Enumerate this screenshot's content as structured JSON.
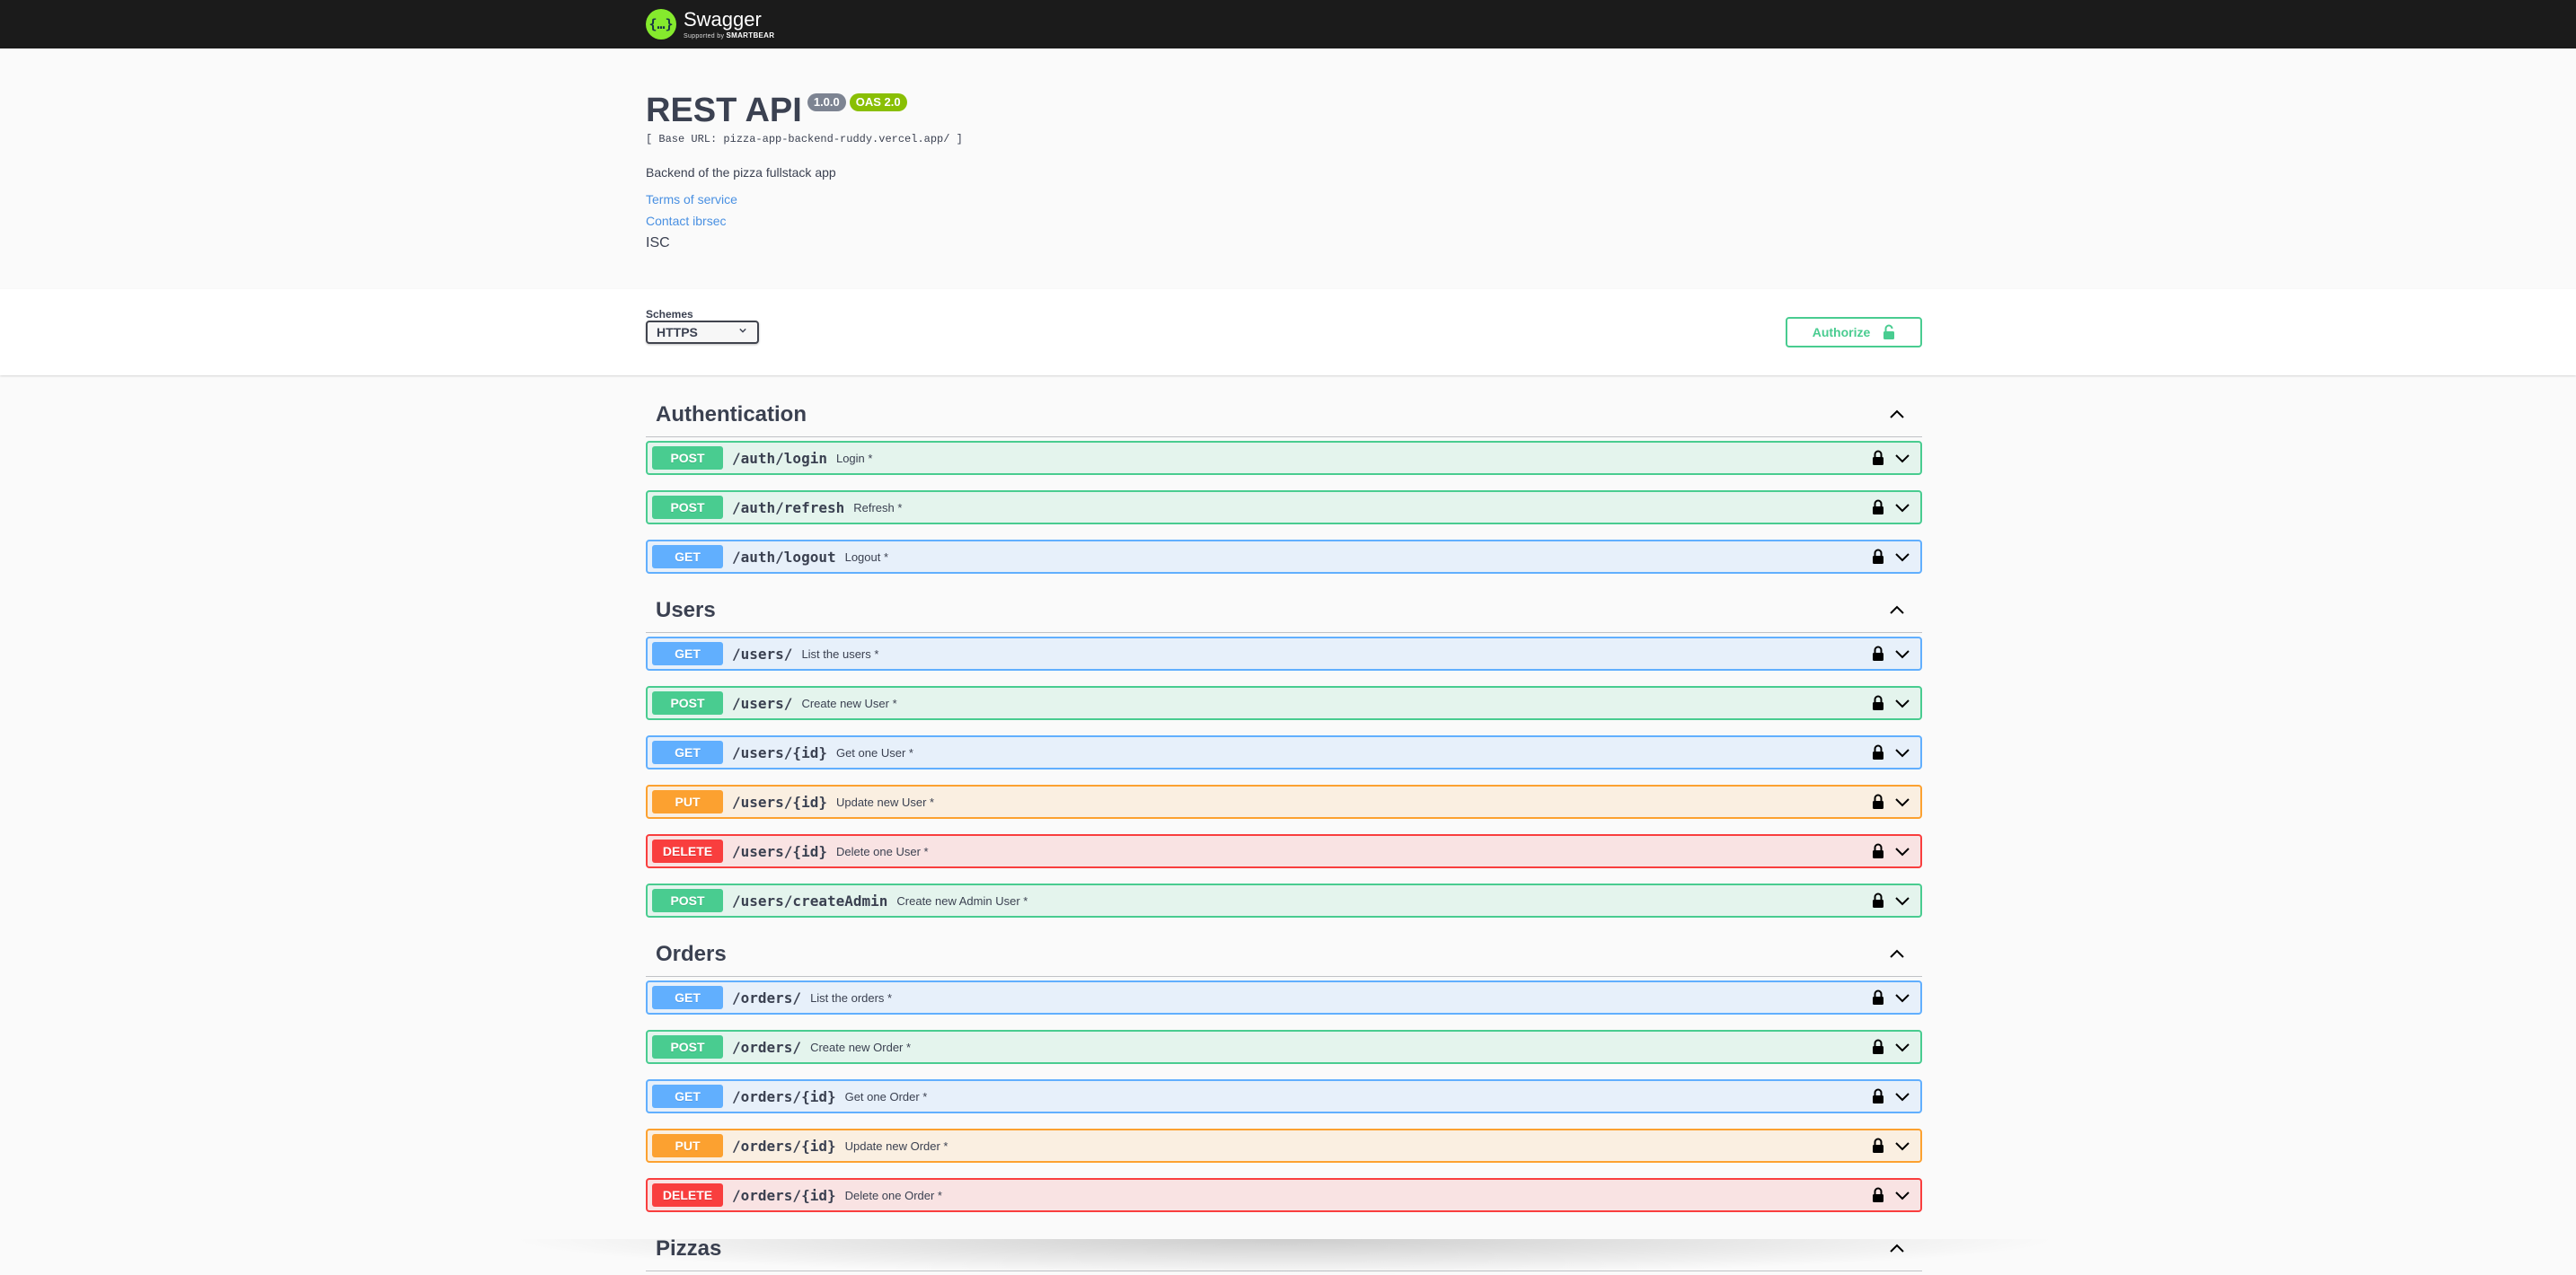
{
  "topbar": {
    "logo_mark": "{…}",
    "brand": "Swagger",
    "supported_by": "Supported by",
    "smartbear": "SMARTBEAR"
  },
  "info": {
    "title": "REST API",
    "version": "1.0.0",
    "oas": "OAS 2.0",
    "base_url": "[ Base URL: pizza-app-backend-ruddy.vercel.app/ ]",
    "description": "Backend of the pizza fullstack app",
    "terms_link": "Terms of service",
    "contact_link": "Contact ibrsec",
    "license": "ISC"
  },
  "schemes": {
    "label": "Schemes",
    "selected": "HTTPS"
  },
  "authorize": {
    "label": "Authorize"
  },
  "colors": {
    "post": "#49cc90",
    "get": "#61affe",
    "put": "#fca130",
    "delete": "#f93e3e"
  },
  "sections": [
    {
      "name": "Authentication",
      "ops": [
        {
          "method": "POST",
          "path": "/auth/login",
          "summary": "Login *"
        },
        {
          "method": "POST",
          "path": "/auth/refresh",
          "summary": "Refresh *"
        },
        {
          "method": "GET",
          "path": "/auth/logout",
          "summary": "Logout *"
        }
      ]
    },
    {
      "name": "Users",
      "ops": [
        {
          "method": "GET",
          "path": "/users/",
          "summary": "List the users *"
        },
        {
          "method": "POST",
          "path": "/users/",
          "summary": "Create new User *"
        },
        {
          "method": "GET",
          "path": "/users/{id}",
          "summary": "Get one User *"
        },
        {
          "method": "PUT",
          "path": "/users/{id}",
          "summary": "Update new User *"
        },
        {
          "method": "DELETE",
          "path": "/users/{id}",
          "summary": "Delete one User *"
        },
        {
          "method": "POST",
          "path": "/users/createAdmin",
          "summary": "Create new Admin User *"
        }
      ]
    },
    {
      "name": "Orders",
      "ops": [
        {
          "method": "GET",
          "path": "/orders/",
          "summary": "List the orders *"
        },
        {
          "method": "POST",
          "path": "/orders/",
          "summary": "Create new Order *"
        },
        {
          "method": "GET",
          "path": "/orders/{id}",
          "summary": "Get one Order *"
        },
        {
          "method": "PUT",
          "path": "/orders/{id}",
          "summary": "Update new Order *"
        },
        {
          "method": "DELETE",
          "path": "/orders/{id}",
          "summary": "Delete one Order *"
        }
      ]
    },
    {
      "name": "Pizzas",
      "ops": []
    }
  ]
}
